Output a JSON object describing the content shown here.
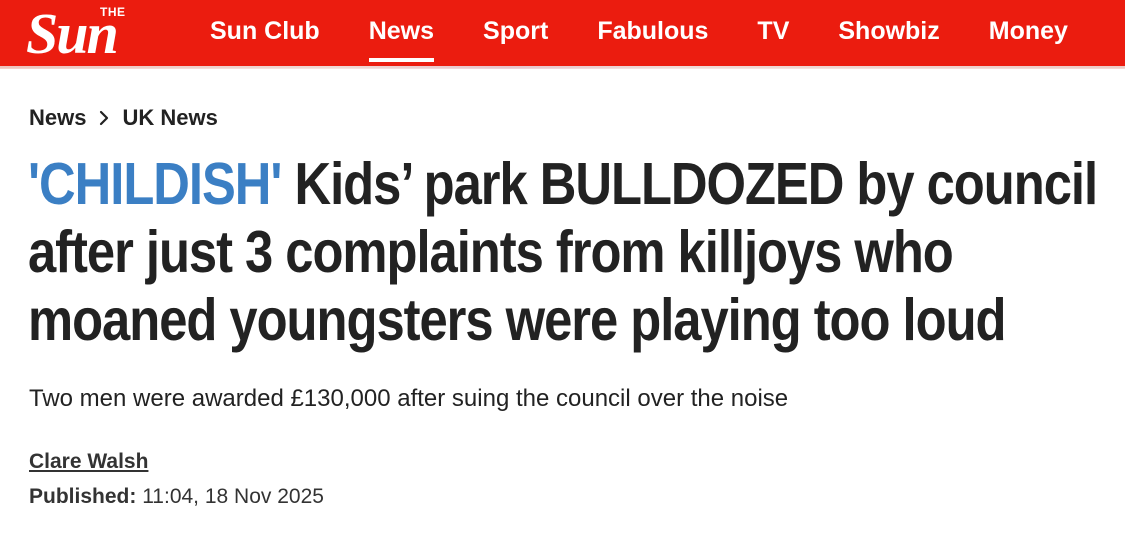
{
  "brand": {
    "logo_small": "THE",
    "logo_main": "Sun"
  },
  "nav": {
    "items": [
      {
        "label": "Sun Club"
      },
      {
        "label": "News"
      },
      {
        "label": "Sport"
      },
      {
        "label": "Fabulous"
      },
      {
        "label": "TV"
      },
      {
        "label": "Showbiz"
      },
      {
        "label": "Money"
      }
    ],
    "active": "News"
  },
  "breadcrumb": {
    "items": [
      "News",
      "UK News"
    ]
  },
  "article": {
    "kicker": "'CHILDISH'",
    "headline": "Kids’ park BULLDOZED by council after just 3 complaints from killjoys who moaned youngsters were playing too loud",
    "standfirst": "Two men were awarded £130,000 after suing the council over the noise",
    "author": "Clare Walsh",
    "published_label": "Published:",
    "published_value": "11:04, 18 Nov 2025"
  },
  "colors": {
    "brand_red": "#eb1c0f",
    "kicker_blue": "#3b7fc4",
    "text": "#222222"
  },
  "icons": {
    "breadcrumb_separator": "chevron-right-icon"
  }
}
